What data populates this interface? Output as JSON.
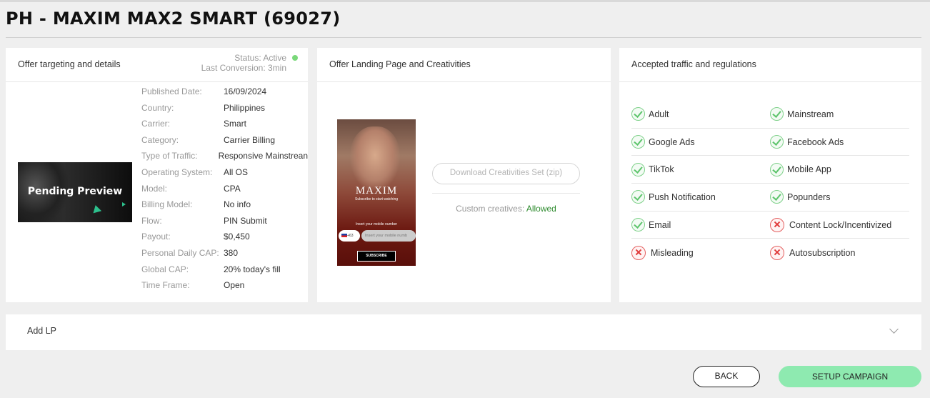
{
  "page_title": "PH - MAXIM MAX2 SMART (69027)",
  "offer_card": {
    "title": "Offer targeting and details",
    "status": "Status: Active",
    "last_conversion": "Last Conversion: 3min",
    "preview_label": "Pending Preview",
    "details": [
      {
        "label": "Published Date:",
        "value": "16/09/2024"
      },
      {
        "label": "Country:",
        "value": "Philippines"
      },
      {
        "label": "Carrier:",
        "value": "Smart"
      },
      {
        "label": "Category:",
        "value": "Carrier Billing"
      },
      {
        "label": "Type of Traffic:",
        "value": "Responsive Mainstrean"
      },
      {
        "label": "Operating System:",
        "value": "All OS"
      },
      {
        "label": "Model:",
        "value": "CPA"
      },
      {
        "label": "Billing Model:",
        "value": "No info"
      },
      {
        "label": "Flow:",
        "value": "PIN Submit"
      },
      {
        "label": "Payout:",
        "value": "$0,450"
      },
      {
        "label": "Personal Daily CAP:",
        "value": "380"
      },
      {
        "label": "Global CAP:",
        "value": "20% today's fill"
      },
      {
        "label": "Time Frame:",
        "value": "Open"
      }
    ]
  },
  "lp_card": {
    "title": "Offer Landing Page and Creativities",
    "creative": {
      "brand": "MAXIM",
      "tagline": "Subscribe to start watching",
      "mobile_label": "Insert your mobile number",
      "country_code": "+63",
      "input_placeholder": "Insert your mobile numb",
      "subscribe": "SUBSCRIBE"
    },
    "download_label": "Download Creativities Set (zip)",
    "custom_creatives_label": "Custom creatives:",
    "custom_creatives_value": "Allowed"
  },
  "traffic_card": {
    "title": "Accepted traffic and regulations",
    "rows": [
      [
        {
          "label": "Adult",
          "allowed": true
        },
        {
          "label": "Mainstream",
          "allowed": true
        }
      ],
      [
        {
          "label": "Google Ads",
          "allowed": true
        },
        {
          "label": "Facebook Ads",
          "allowed": true
        }
      ],
      [
        {
          "label": "TikTok",
          "allowed": true
        },
        {
          "label": "Mobile App",
          "allowed": true
        }
      ],
      [
        {
          "label": "Push Notification",
          "allowed": true
        },
        {
          "label": "Popunders",
          "allowed": true
        }
      ],
      [
        {
          "label": "Email",
          "allowed": true
        },
        {
          "label": "Content Lock/Incentivized",
          "allowed": false
        }
      ],
      [
        {
          "label": "Misleading",
          "allowed": false
        },
        {
          "label": "Autosubscription",
          "allowed": false
        }
      ]
    ]
  },
  "add_lp": {
    "label": "Add LP"
  },
  "footer": {
    "back_label": "BACK",
    "setup_label": "SETUP CAMPAIGN"
  },
  "colors": {
    "active_dot": "#7ad87a",
    "allowed_text": "#2e8b2e",
    "setup_button": "#8eeab0",
    "reject": "#e03b3b"
  }
}
